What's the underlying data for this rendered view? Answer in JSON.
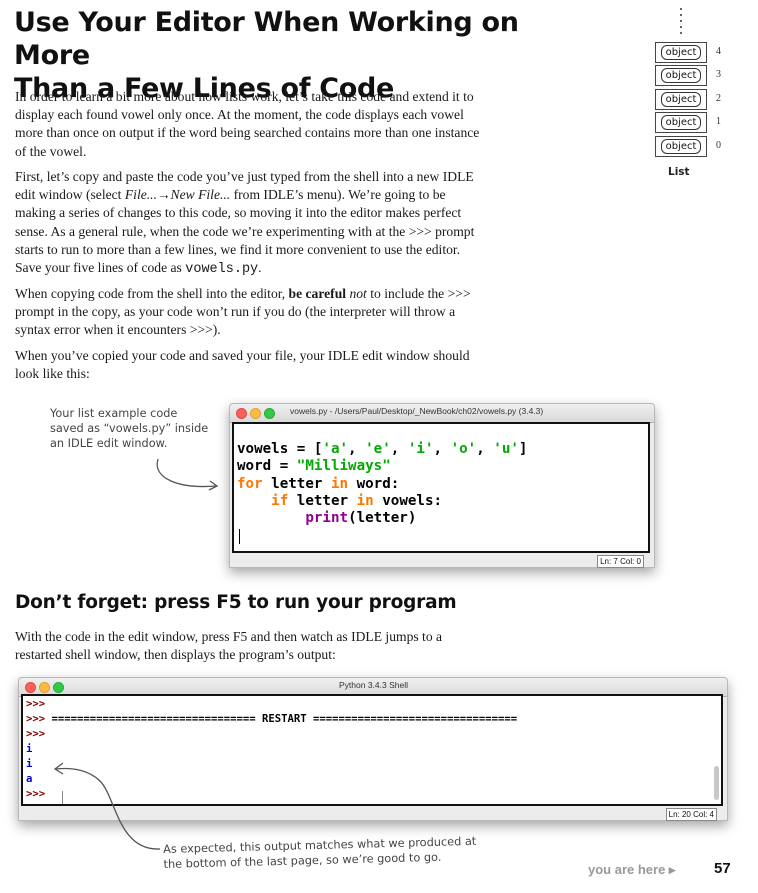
{
  "title": {
    "line1": "Use Your Editor When Working on More",
    "line2": "Than a Few Lines of Code"
  },
  "paragraphs": {
    "p1": "In order to learn a bit more about how lists work, let’s take this code and extend it to display each found vowel only once. At the moment, the code displays each vowel more than once on output if the word being searched contains more than one instance of the vowel.",
    "p2_a": "First, let’s copy and paste the code you’ve just typed from the shell into a new IDLE edit window (select ",
    "p2_menu": "File...→New File...",
    "p2_b": " from IDLE’s menu). We’re going to be making a series of changes to this code, so moving it into the editor makes perfect sense. As a general rule, when the code we’re experimenting with at the >>> prompt starts to run to more than a few lines, we find it more convenient to use the editor. Save your five lines of code as ",
    "p2_file": "vowels.py",
    "p2_c": ".",
    "p3_a": "When copying code from the shell into the editor, ",
    "p3_bold": "be careful",
    "p3_space": " ",
    "p3_not": "not",
    "p3_b": " to include the >>> prompt in the copy, as your code won’t run if you do (the interpreter will throw a syntax error when it encounters >>>).",
    "p4": "When you’ve copied your code and saved your file, your IDLE edit window should look like this:",
    "p5": "With the code in the edit window, press F5 and then watch as IDLE jumps to a restarted shell window, then displays the program’s output:"
  },
  "list_diagram": {
    "label": "List",
    "slots": [
      {
        "text": "object",
        "index": "4"
      },
      {
        "text": "object",
        "index": "3"
      },
      {
        "text": "object",
        "index": "2"
      },
      {
        "text": "object",
        "index": "1"
      },
      {
        "text": "object",
        "index": "0"
      }
    ]
  },
  "notes": {
    "editor_line1": "Your list example code",
    "editor_line2": "saved as “vowels.py” inside",
    "editor_line3": "an IDLE edit window.",
    "output_line1": "As expected, this output matches what we produced at",
    "output_line2": "the bottom of the last page, so we’re good to go."
  },
  "editor_window": {
    "title": "vowels.py - /Users/Paul/Desktop/_NewBook/ch02/vowels.py (3.4.3)",
    "status": "Ln: 7  Col: 0",
    "code": {
      "l1_a": "vowels = [",
      "l1_s1": "'a'",
      "l1_c1": ", ",
      "l1_s2": "'e'",
      "l1_c2": ", ",
      "l1_s3": "'i'",
      "l1_c3": ", ",
      "l1_s4": "'o'",
      "l1_c4": ", ",
      "l1_s5": "'u'",
      "l1_end": "]",
      "l2_a": "word = ",
      "l2_s": "\"Milliways\"",
      "l3_kw1": "for",
      "l3_b": " letter ",
      "l3_kw2": "in",
      "l3_c": " word:",
      "l4_indent": "    ",
      "l4_kw1": "if",
      "l4_b": " letter ",
      "l4_kw2": "in",
      "l4_c": " vowels:",
      "l5_indent": "        ",
      "l5_bi": "print",
      "l5_b": "(letter)"
    }
  },
  "subheading": "Don’t forget: press F5 to run your program",
  "shell_window": {
    "title": "Python 3.4.3 Shell",
    "status": "Ln: 20  Col: 4",
    "prompt": ">>>",
    "restart_line": " ================================ RESTART ================================",
    "outputs": [
      "i",
      "i",
      "a"
    ]
  },
  "footer": {
    "you_are_here": "you are here ▸",
    "page_number": "57"
  }
}
